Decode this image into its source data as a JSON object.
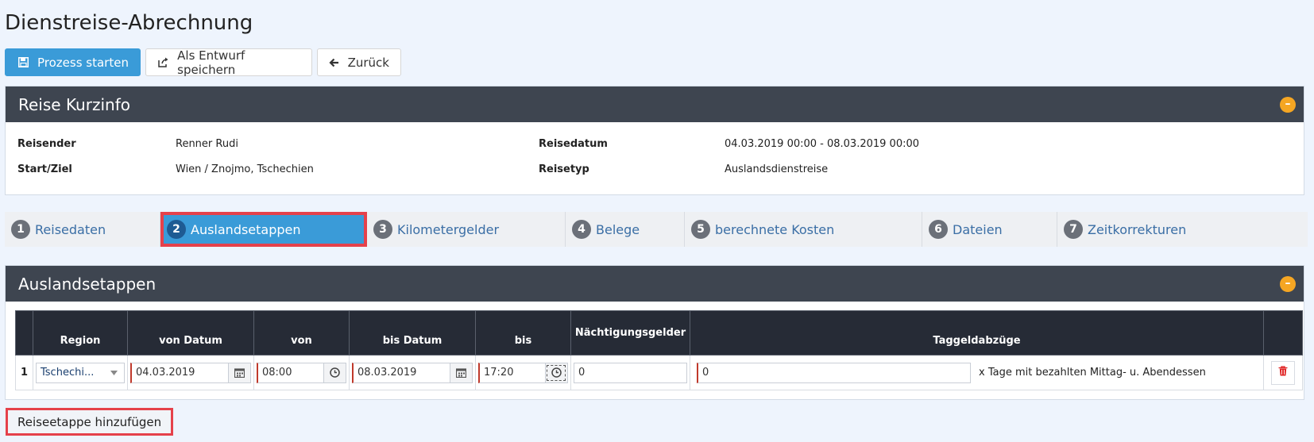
{
  "page": {
    "title": "Dienstreise-Abrechnung"
  },
  "toolbar": {
    "start_label": "Prozess starten",
    "draft_label": "Als Entwurf speichern",
    "back_label": "Zurück"
  },
  "info": {
    "title": "Reise Kurzinfo",
    "collapse_symbol": "–",
    "traveler_label": "Reisender",
    "traveler_value": "Renner Rudi",
    "route_label": "Start/Ziel",
    "route_value": "Wien / Znojmo, Tschechien",
    "date_label": "Reisedatum",
    "date_value": "04.03.2019 00:00 - 08.03.2019 00:00",
    "type_label": "Reisetyp",
    "type_value": "Auslandsdienstreise"
  },
  "steps": [
    {
      "num": "1",
      "label": "Reisedaten"
    },
    {
      "num": "2",
      "label": "Auslandsetappen",
      "active": true
    },
    {
      "num": "3",
      "label": "Kilometergelder"
    },
    {
      "num": "4",
      "label": "Belege"
    },
    {
      "num": "5",
      "label": "berechnete Kosten"
    },
    {
      "num": "6",
      "label": "Dateien"
    },
    {
      "num": "7",
      "label": "Zeitkorrekturen"
    }
  ],
  "stages": {
    "title": "Auslandsetappen",
    "collapse_symbol": "–",
    "columns": [
      "Region",
      "von Datum",
      "von",
      "bis Datum",
      "bis",
      "Nächtigungsgelder",
      "Taggeldabzüge"
    ],
    "rows": [
      {
        "index": "1",
        "region": "Tschechi...",
        "from_date": "04.03.2019",
        "from_time": "08:00",
        "to_date": "08.03.2019",
        "to_time": "17:20",
        "overnight": "0",
        "deduction": "0",
        "deduction_suffix": "x Tage mit bezahlten Mittag- u. Abendessen"
      }
    ]
  },
  "add_stage_label": "Reiseetappe hinzufügen",
  "colors": {
    "primary": "#3a9bd8",
    "header": "#3e4550",
    "highlight": "#e5414b",
    "collapse": "#f5a623"
  },
  "icons": [
    "save-icon",
    "share-icon",
    "arrow-left-icon",
    "calendar-icon",
    "clock-icon",
    "trash-icon",
    "chevron-down-icon"
  ]
}
